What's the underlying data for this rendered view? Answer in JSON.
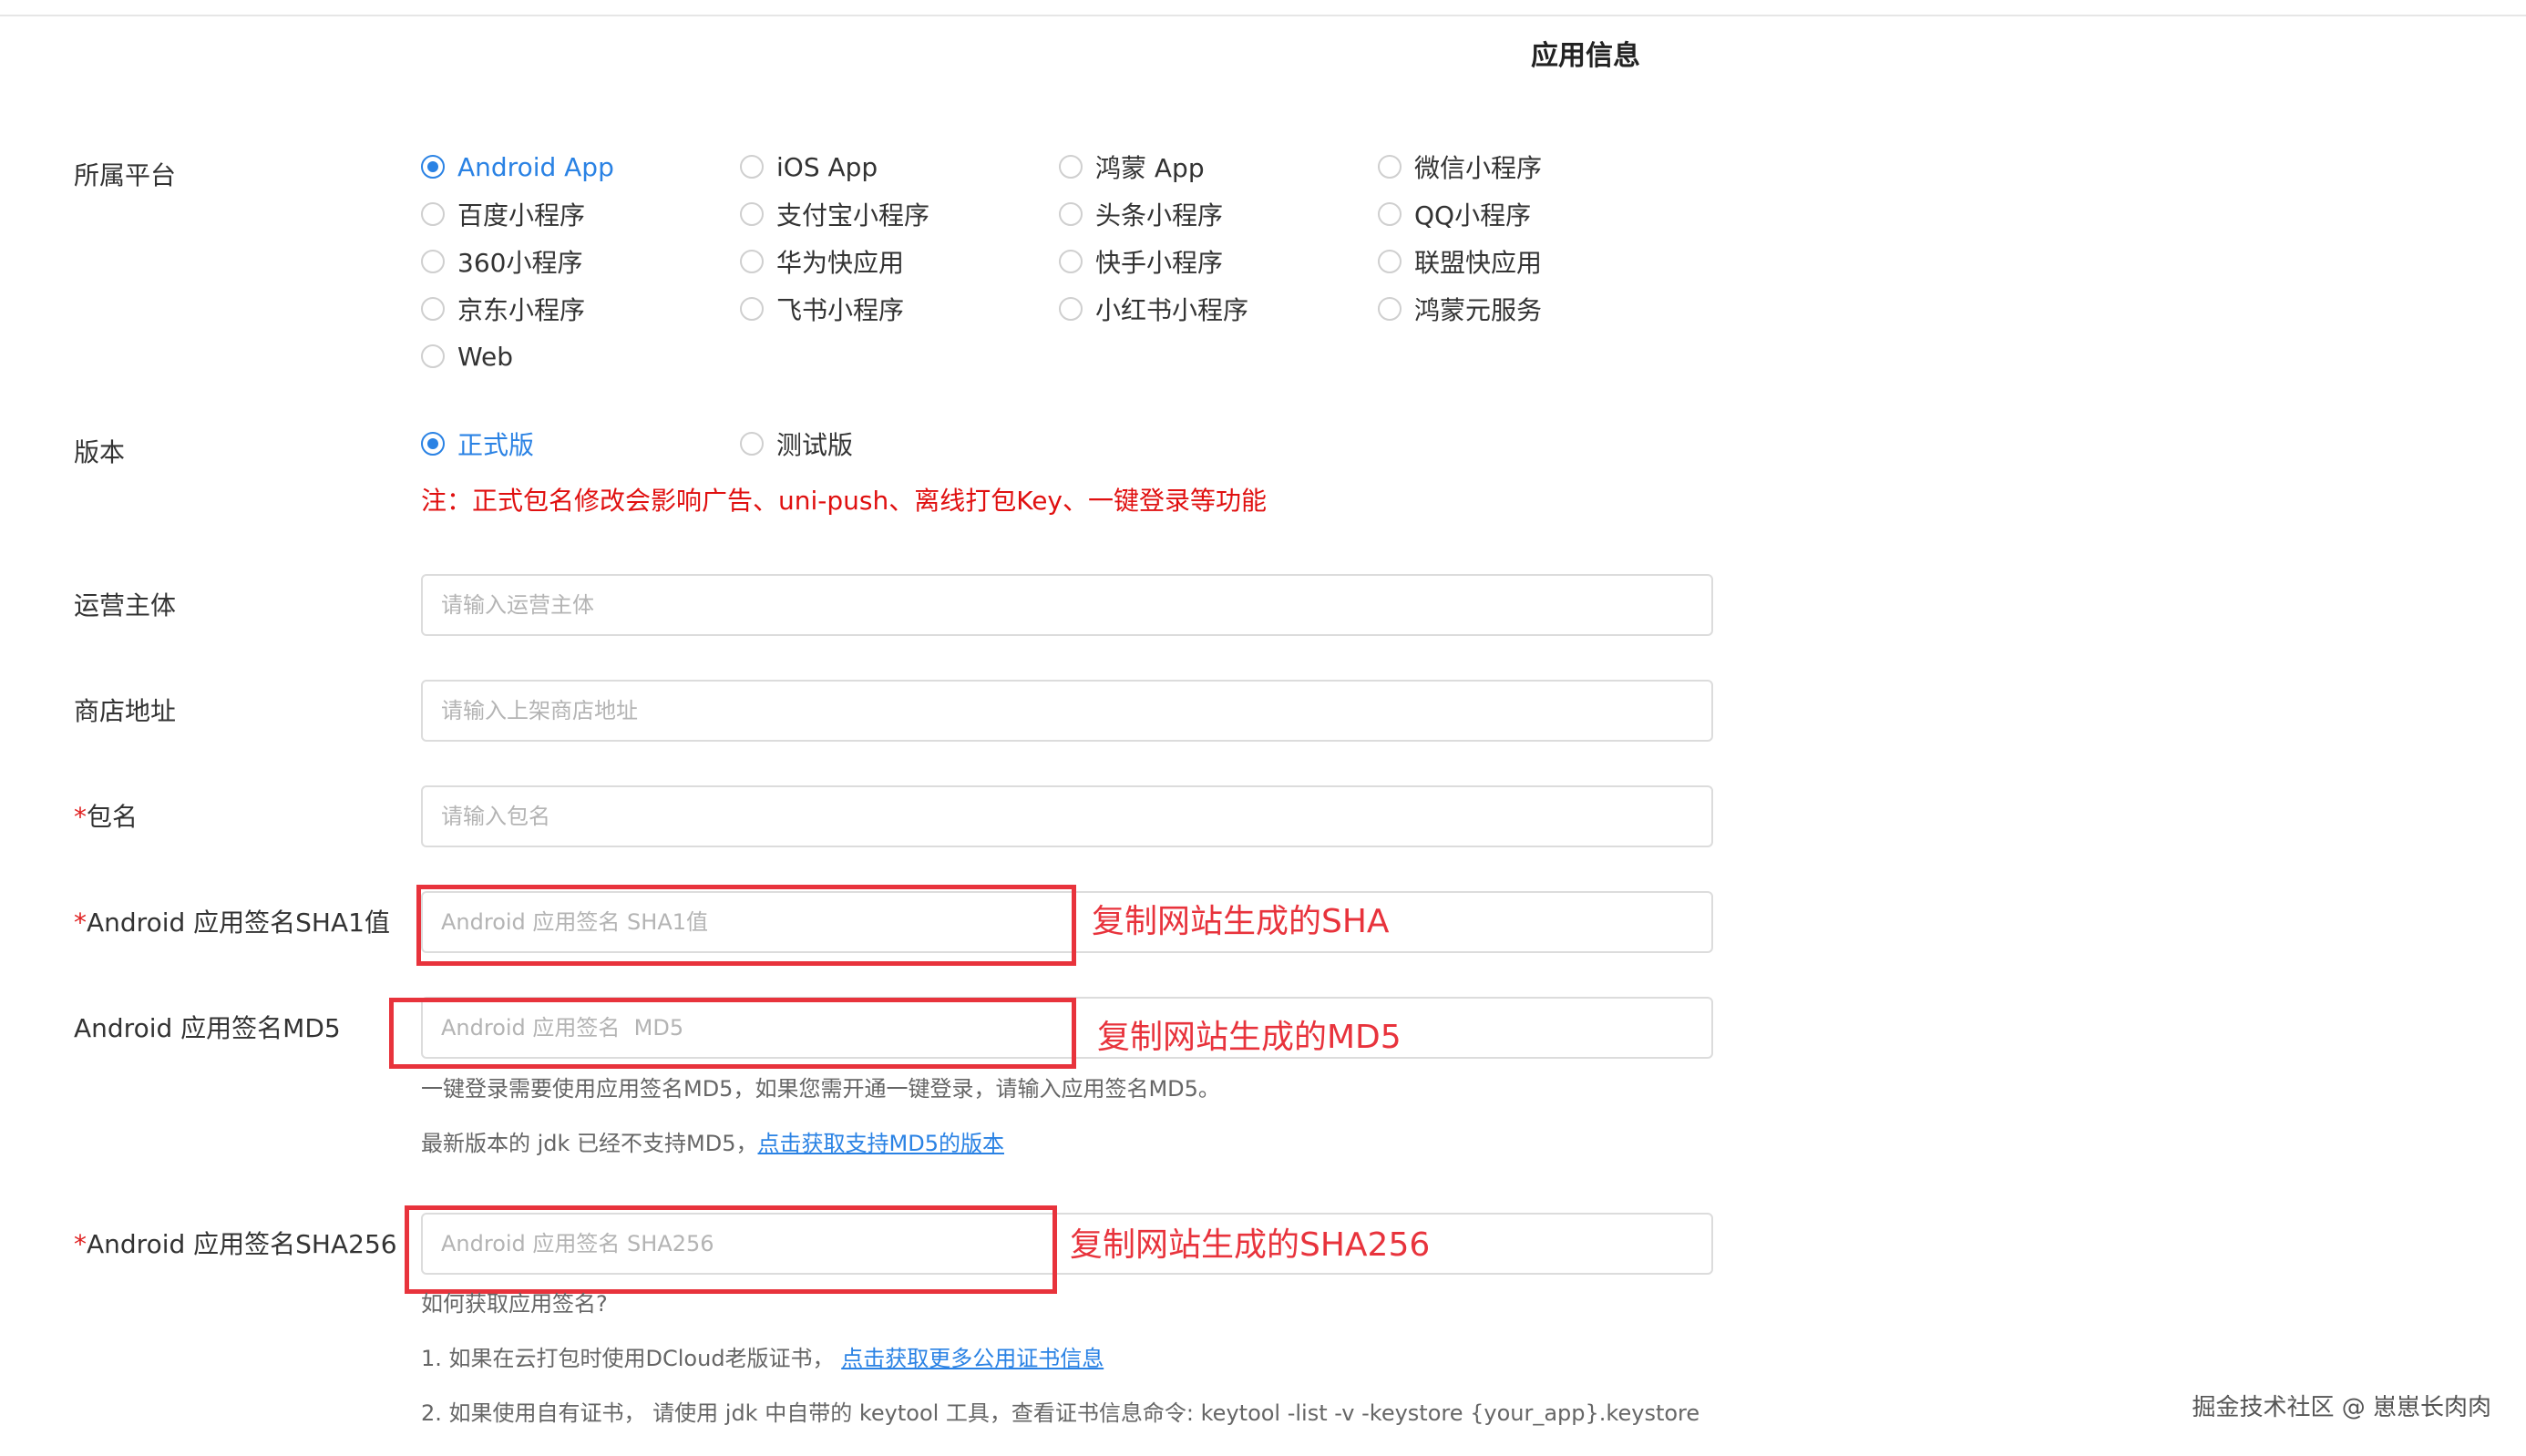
{
  "section_title": "应用信息",
  "platform": {
    "label": "所属平台",
    "options": [
      {
        "label": "Android App",
        "checked": true
      },
      {
        "label": "iOS App",
        "checked": false
      },
      {
        "label": "鸿蒙 App",
        "checked": false
      },
      {
        "label": "微信小程序",
        "checked": false
      },
      {
        "label": "百度小程序",
        "checked": false
      },
      {
        "label": "支付宝小程序",
        "checked": false
      },
      {
        "label": "头条小程序",
        "checked": false
      },
      {
        "label": "QQ小程序",
        "checked": false
      },
      {
        "label": "360小程序",
        "checked": false
      },
      {
        "label": "华为快应用",
        "checked": false
      },
      {
        "label": "快手小程序",
        "checked": false
      },
      {
        "label": "联盟快应用",
        "checked": false
      },
      {
        "label": "京东小程序",
        "checked": false
      },
      {
        "label": "飞书小程序",
        "checked": false
      },
      {
        "label": "小红书小程序",
        "checked": false
      },
      {
        "label": "鸿蒙元服务",
        "checked": false
      },
      {
        "label": "Web",
        "checked": false
      }
    ]
  },
  "version": {
    "label": "版本",
    "options": [
      {
        "label": "正式版",
        "checked": true
      },
      {
        "label": "测试版",
        "checked": false
      }
    ],
    "warning": "注：正式包名修改会影响广告、uni-push、离线打包Key、一键登录等功能"
  },
  "fields": {
    "operator": {
      "label": "运营主体",
      "placeholder": "请输入运营主体",
      "value": ""
    },
    "store_url": {
      "label": "商店地址",
      "placeholder": "请输入上架商店地址",
      "value": ""
    },
    "package": {
      "required_mark": "*",
      "label": "包名",
      "placeholder": "请输入包名",
      "value": ""
    },
    "sha1": {
      "required_mark": "*",
      "label": "Android 应用签名SHA1值",
      "placeholder": "Android 应用签名 SHA1值",
      "value": ""
    },
    "md5": {
      "label": "Android 应用签名MD5",
      "placeholder": "Android 应用签名  MD5",
      "value": ""
    },
    "sha256": {
      "required_mark": "*",
      "label": "Android 应用签名SHA256",
      "placeholder": "Android 应用签名 SHA256",
      "value": ""
    }
  },
  "md5_help": {
    "line1": "一键登录需要使用应用签名MD5，如果您需开通一键登录，请输入应用签名MD5。",
    "line2_prefix": "最新版本的 jdk 已经不支持MD5，",
    "line2_link": "点击获取支持MD5的版本"
  },
  "sha256_help": {
    "title": "如何获取应用签名?",
    "line1_prefix": "1. 如果在云打包时使用DCloud老版证书， ",
    "line1_link": "点击获取更多公用证书信息",
    "line2": "2. 如果使用自有证书， 请使用 jdk 中自带的 keytool 工具，查看证书信息命令: keytool -list -v -keystore {your_app}.keystore"
  },
  "annotations": {
    "sha1": "复制网站生成的SHA",
    "md5": "复制网站生成的MD5",
    "sha256": "复制网站生成的SHA256",
    "color": "#e8333c"
  },
  "watermark": "掘金技术社区 @ 崽崽长肉肉",
  "colors": {
    "accent": "#2a82e4",
    "warning": "#e01010"
  }
}
